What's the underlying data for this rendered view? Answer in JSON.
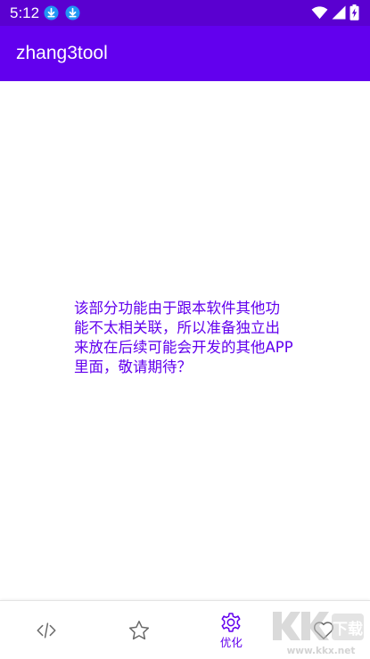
{
  "status_bar": {
    "time": "5:12",
    "icons": [
      "download-icon",
      "download-icon",
      "wifi-icon",
      "signal-icon",
      "battery-charging-icon"
    ]
  },
  "app_bar": {
    "title": "zhang3tool"
  },
  "main": {
    "notice": "该部分功能由于跟本软件其他功能不太相关联，所以准备独立出来放在后续可能会开发的其他APP里面，敬请期待？"
  },
  "bottom_nav": {
    "items": [
      {
        "icon": "code-icon",
        "label": "",
        "active": false
      },
      {
        "icon": "star-icon",
        "label": "",
        "active": false
      },
      {
        "icon": "gear-icon",
        "label": "优化",
        "active": true
      },
      {
        "icon": "heart-icon",
        "label": "",
        "active": false
      }
    ]
  },
  "watermark": {
    "text": "KK下载",
    "url": "www.kkx.net"
  },
  "colors": {
    "primary": "#6200ee",
    "primary_dark": "#5a00d0",
    "inactive_icon": "#6b6b6b",
    "background": "#ffffff"
  }
}
